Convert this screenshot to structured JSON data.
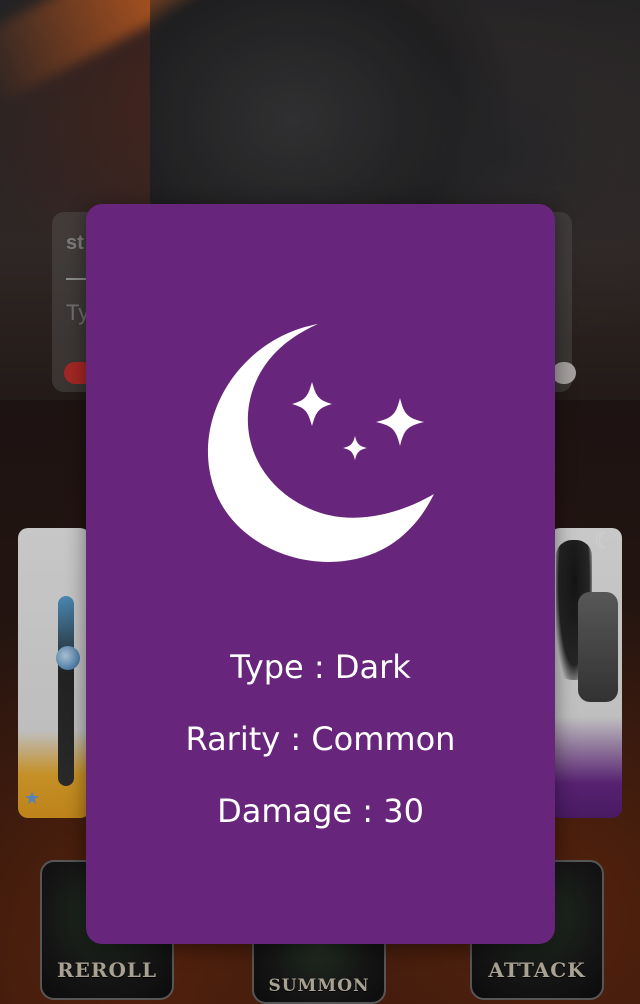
{
  "background": {
    "panel": {
      "partial_text": "st",
      "input_placeholder_partial": "Ty"
    },
    "buttons": {
      "reroll_label": "REROLL",
      "summon_label": "SUMMON",
      "attack_label": "ATTACK"
    }
  },
  "card_modal": {
    "icon": "moon-stars-icon",
    "background_color": "#67257b",
    "type": "Type : Dark",
    "rarity": "Rarity : Common",
    "damage": "Damage : 30"
  }
}
